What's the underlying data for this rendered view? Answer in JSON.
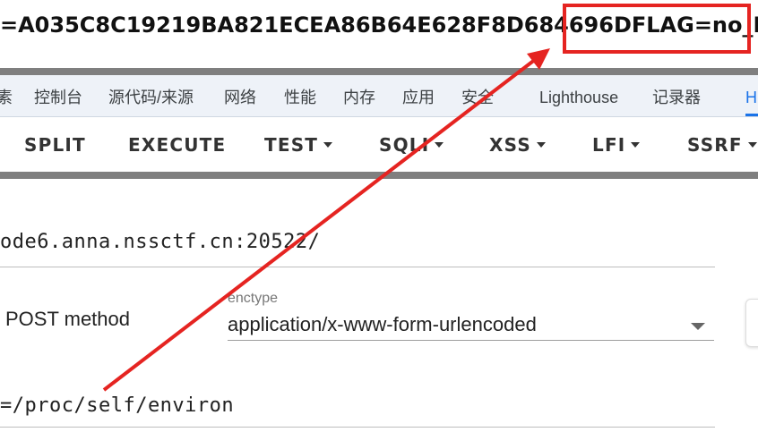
{
  "output": {
    "prefix": "=A035C8C19219BA821ECEA86B64E628F8D684696D",
    "highlighted": "FLAG=no_FLAGS"
  },
  "devtools": {
    "tabs": [
      "素",
      "控制台",
      "源代码/来源",
      "网络",
      "性能",
      "内存",
      "应用",
      "安全",
      "Lighthouse",
      "记录器",
      "H"
    ],
    "active_tab": "H"
  },
  "hackbar": {
    "buttons": [
      "SPLIT",
      "EXECUTE",
      "TEST",
      "SQLI",
      "XSS",
      "LFI",
      "SSRF"
    ],
    "url": "ode6.anna.nssctf.cn:20522/",
    "post_label": "POST method",
    "enctype_label": "enctype",
    "enctype_value": "application/x-www-form-urlencoded",
    "body": "=/proc/self/environ"
  },
  "colors": {
    "annotation": "#e52421",
    "active_tab": "#1a73e8",
    "separator": "#7f7f7f"
  }
}
